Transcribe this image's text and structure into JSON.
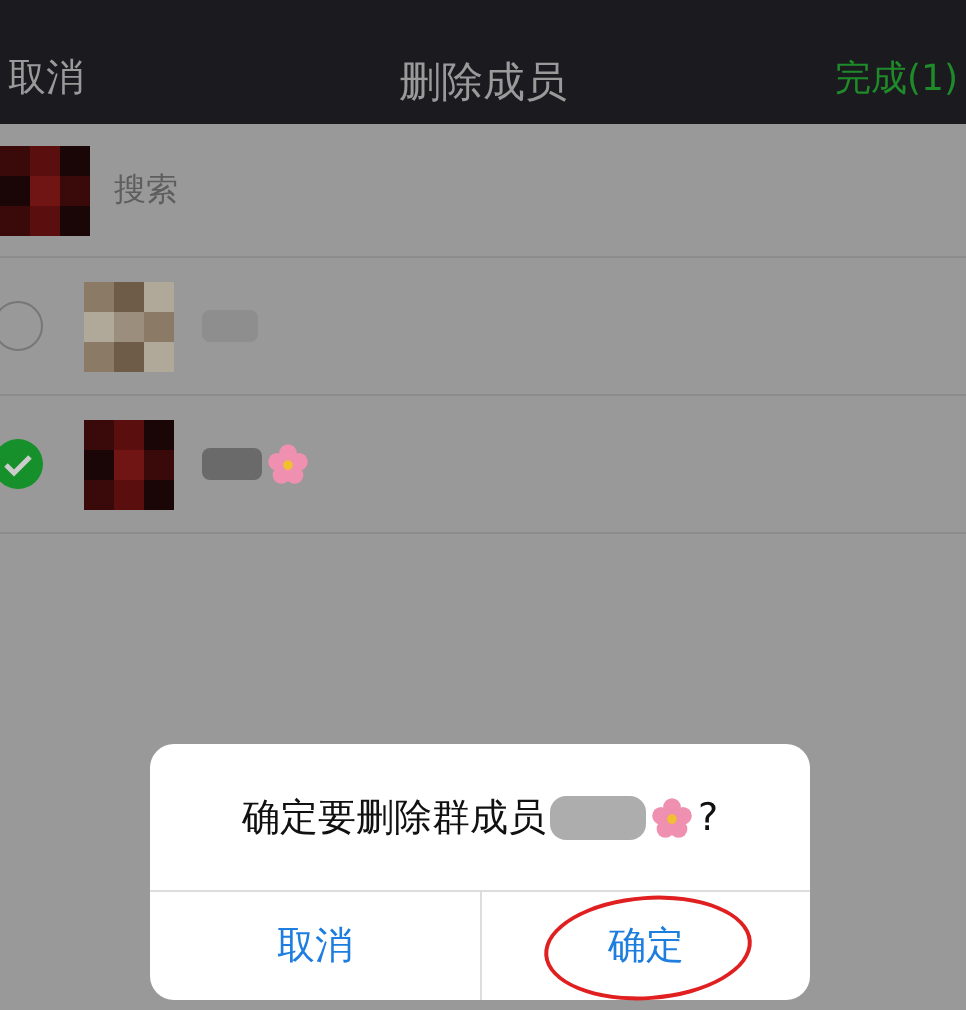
{
  "nav": {
    "cancel": "取消",
    "title": "删除成员",
    "done": "完成(1)"
  },
  "search": {
    "placeholder": "搜索"
  },
  "members": [
    {
      "selected": false,
      "has_flower": false
    },
    {
      "selected": true,
      "has_flower": true
    }
  ],
  "dialog": {
    "message": "确定要删除群成员",
    "suffix": "?",
    "buttons": [
      {
        "label": "取消",
        "circled": false
      },
      {
        "label": "确定",
        "circled": true
      }
    ]
  }
}
